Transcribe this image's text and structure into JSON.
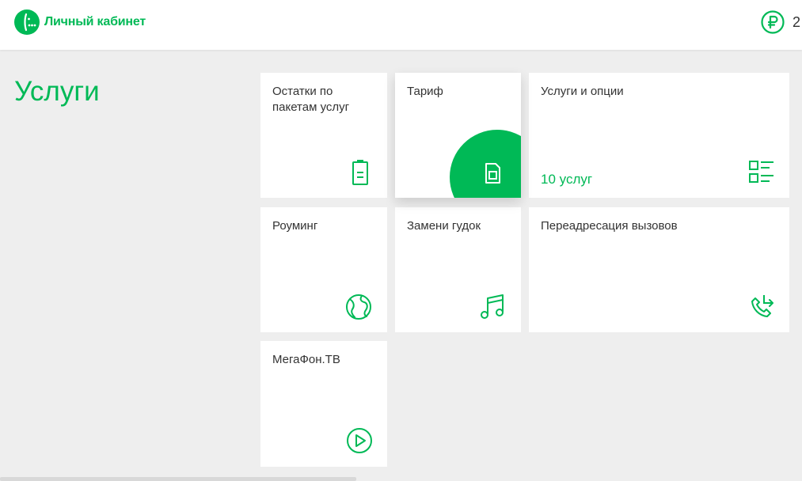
{
  "header": {
    "logo_text": "Личный кабинет",
    "balance_value": "2",
    "brand_color": "#00b956",
    "logo_icon": "megafon-logo-icon",
    "balance_icon": "ruble-icon"
  },
  "page": {
    "title": "Услуги"
  },
  "tiles": [
    {
      "label": "Остатки по пакетам услуг",
      "icon": "battery-icon"
    },
    {
      "label": "Тариф",
      "icon": "sim-card-icon"
    },
    {
      "label": "Услуги и опции",
      "count": "10 услуг",
      "icon": "list-icon"
    },
    {
      "label": "Роуминг",
      "icon": "globe-icon"
    },
    {
      "label": "Замени гудок",
      "icon": "music-note-icon"
    },
    {
      "label": "Переадресация вызовов",
      "icon": "call-forward-icon"
    },
    {
      "label": "МегаФон.ТВ",
      "icon": "play-icon"
    }
  ]
}
